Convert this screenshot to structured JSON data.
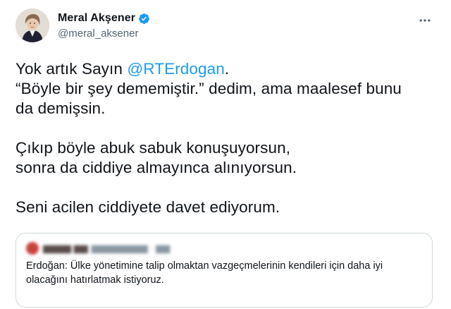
{
  "author": {
    "display_name": "Meral Akşener",
    "handle": "@meral_aksener",
    "verified": true
  },
  "tweet": {
    "line1_prefix": "Yok artık Sayın ",
    "mention": "@RTErdogan",
    "line1_suffix": ".",
    "line2": "“Böyle bir şey dememiştir.” dedim, ama maalesef bunu",
    "line3": "da demişsin.",
    "line4": "Çıkıp böyle abuk sabuk konuşuyorsun,",
    "line5": "sonra da ciddiye almayınca alınıyorsun.",
    "line6": "Seni acilen ciddiyete davet ediyorum."
  },
  "quoted_tweet": {
    "text_line1": "Erdoğan: Ülke yönetimine talip olmaktan vazgeçmelerinin kendileri için daha iyi",
    "text_line2": "olacağını hatırlatmak istiyoruz."
  },
  "icons": {
    "verified": "verified-badge-icon",
    "more": "more-options-icon"
  },
  "colors": {
    "accent": "#1d9bf0",
    "text": "#0f1419",
    "secondary": "#536471",
    "border": "#cfd9de"
  }
}
